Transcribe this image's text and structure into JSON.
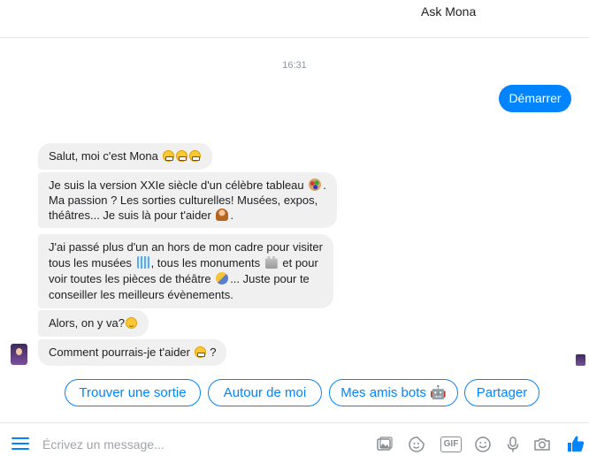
{
  "header": {
    "title": "Ask Mona"
  },
  "timestamp": "16:31",
  "user_message": "Démarrer",
  "bot_messages": {
    "m1": {
      "text": "Salut, moi c'est Mona"
    },
    "m2": {
      "line1": "Je suis la version XXIe siècle d'un célèbre tableau",
      "line2": "Ma passion ? Les sorties culturelles!  Musées, expos,",
      "line3": "théâtres... Je suis là pour t'aider",
      "line3_end": "."
    },
    "m3": {
      "line1": "J'ai passé plus d'un an hors de mon cadre pour visiter",
      "line2a": "tous les musées",
      "line2b": ", tous les monuments",
      "line2c": "et pour",
      "line3a": "voir toutes les pièces de théâtre",
      "line3b": "... Juste pour te",
      "line4": "conseiller les meilleurs évènements."
    },
    "m4": {
      "text": "Alors, on y va?"
    },
    "m5": {
      "text": "Comment pourrais-je t'aider",
      "end": "?"
    }
  },
  "quick_replies": [
    "Trouver une sortie",
    "Autour de moi",
    "Mes amis bots 🤖",
    "Partager"
  ],
  "composer": {
    "placeholder": "Écrivez un message..."
  },
  "colors": {
    "accent": "#0084ff",
    "bubble": "#f1f0f0",
    "icon": "#8a8d91"
  },
  "icons": [
    "menu-icon",
    "image-icon",
    "sticker-icon",
    "gif-icon",
    "emoji-icon",
    "microphone-icon",
    "camera-icon",
    "thumbs-up-icon"
  ]
}
